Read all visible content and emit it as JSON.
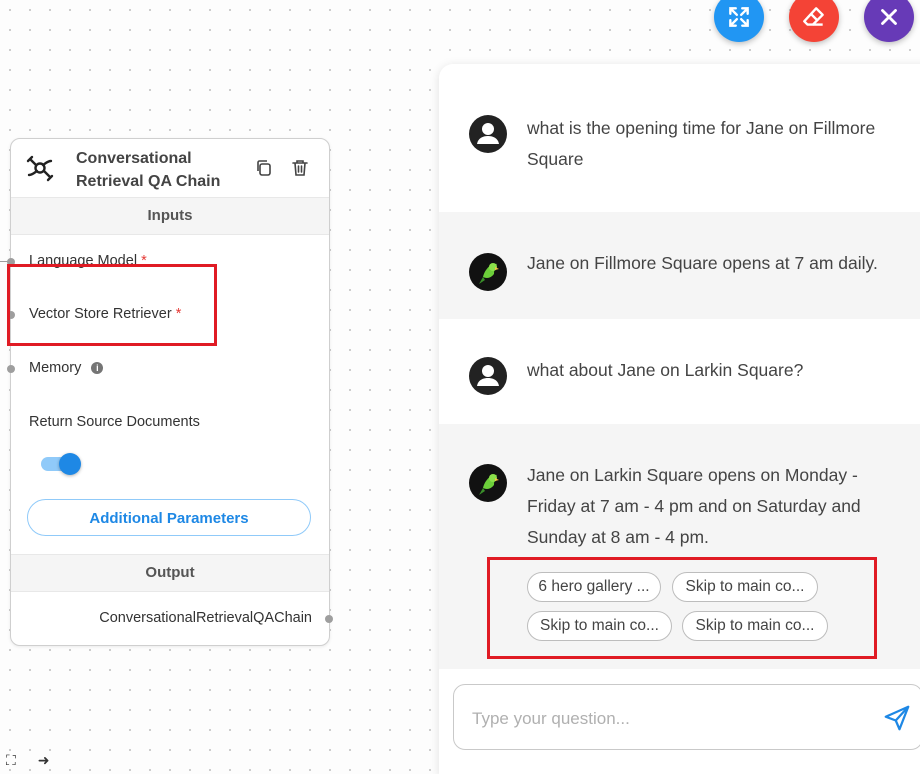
{
  "colors": {
    "expand": "#2196f3",
    "clear": "#f44336",
    "close": "#673ab7",
    "highlight": "#e01b24",
    "accent": "#1e88e5"
  },
  "toolbar": {
    "expand_icon": "expand-arrows-icon",
    "clear_icon": "eraser-icon",
    "close_icon": "close-icon"
  },
  "node": {
    "title": "Conversational Retrieval QA Chain",
    "inputs_header": "Inputs",
    "params": {
      "language_model": "Language Model",
      "vector_store_retriever": "Vector Store Retriever",
      "memory": "Memory",
      "return_source_documents": "Return Source Documents"
    },
    "required_mark": "*",
    "info_mark": "i",
    "return_source_documents_enabled": true,
    "additional_parameters": "Additional Parameters",
    "output_header": "Output",
    "output_label": "ConversationalRetrievalQAChain"
  },
  "chat": {
    "messages": [
      {
        "role": "user",
        "text": "what is the opening time for Jane on Fillmore Square"
      },
      {
        "role": "bot",
        "text": "Jane on Fillmore Square opens at 7 am daily."
      },
      {
        "role": "user",
        "text": "what about Jane on Larkin Square?"
      },
      {
        "role": "bot",
        "text": "Jane on Larkin Square opens on Monday - Friday at 7 am - 4 pm and on Saturday and Sunday at 8 am - 4 pm."
      }
    ],
    "source_chips": [
      "6 hero gallery ...",
      "Skip to main co...",
      "Skip to main co...",
      "Skip to main co..."
    ],
    "input_placeholder": "Type your question..."
  }
}
